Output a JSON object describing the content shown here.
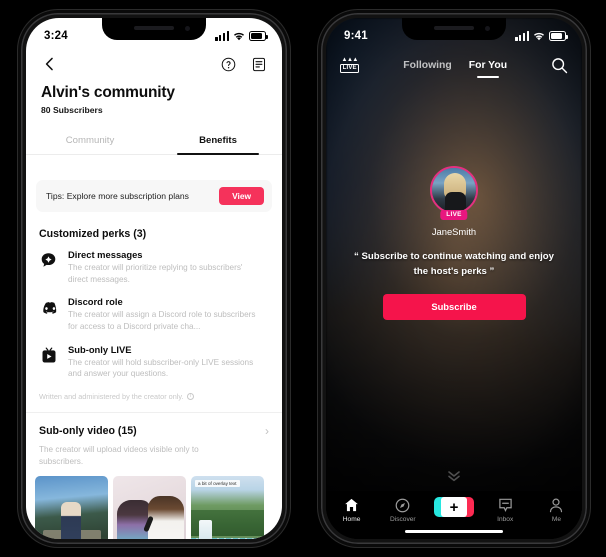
{
  "accent": {
    "pink": "#f5325b",
    "subscribe_red": "#f5144b",
    "live_badge": "#e8177f",
    "avatar_ring": "#e3317f"
  },
  "left_phone": {
    "status": {
      "time": "3:24",
      "signal_icon": "signal-bars-icon",
      "wifi_icon": "wifi-icon",
      "battery_icon": "battery-icon"
    },
    "header": {
      "back_icon": "chevron-left-icon",
      "help_icon": "question-circle-icon",
      "notes_icon": "document-list-icon"
    },
    "page_title": "Alvin's community",
    "subscriber_count": "80 Subscribers",
    "tabs": [
      {
        "label": "Community",
        "active": false
      },
      {
        "label": "Benefits",
        "active": true
      }
    ],
    "tips": {
      "text": "Tips: Explore more subscription plans",
      "button_label": "View"
    },
    "perks_section_title": "Customized perks (3)",
    "perks": [
      {
        "icon": "direct-message-icon",
        "name": "Direct messages",
        "description": "The creator will prioritize replying to subscribers' direct messages."
      },
      {
        "icon": "discord-icon",
        "name": "Discord role",
        "description": "The creator will assign a Discord role to subscribers for access to a Discord private cha..."
      },
      {
        "icon": "sub-only-live-icon",
        "name": "Sub-only LIVE",
        "description": "The creator will hold subscriber-only LIVE sessions and answer your questions."
      }
    ],
    "note": {
      "text": "Written and administered by the creator only.",
      "icon": "info-circle-icon"
    },
    "video_section": {
      "title": "Sub-only video (15)",
      "chevron_icon": "chevron-right-icon",
      "description": "The creator will upload videos visible only to subscribers.",
      "thumbnails": [
        {
          "caption": ""
        },
        {
          "caption": ""
        },
        {
          "caption": "a bit of overlay text"
        }
      ]
    }
  },
  "right_phone": {
    "status": {
      "time": "9:41",
      "signal_icon": "signal-bars-icon",
      "wifi_icon": "wifi-icon",
      "battery_icon": "battery-icon"
    },
    "nav": {
      "live_icon": "live-crown-icon",
      "live_label": "LIVE",
      "tabs": [
        {
          "label": "Following",
          "active": false
        },
        {
          "label": "For You",
          "active": true
        }
      ],
      "search_icon": "search-icon"
    },
    "gate": {
      "avatar_icon": "creator-avatar",
      "live_badge": "LIVE",
      "username": "JaneSmith",
      "message": "“ Subscribe to continue watching and enjoy the host's perks ”",
      "subscribe_label": "Subscribe"
    },
    "scroll_hint_icon": "double-chevron-down-icon",
    "tabbar": [
      {
        "label": "Home",
        "icon": "home-icon",
        "active": true
      },
      {
        "label": "Discover",
        "icon": "compass-icon",
        "active": false
      },
      {
        "label": "",
        "icon": "create-plus-icon",
        "active": false
      },
      {
        "label": "Inbox",
        "icon": "inbox-message-icon",
        "active": false
      },
      {
        "label": "Me",
        "icon": "person-icon",
        "active": false
      }
    ],
    "home_indicator": "home-indicator"
  }
}
